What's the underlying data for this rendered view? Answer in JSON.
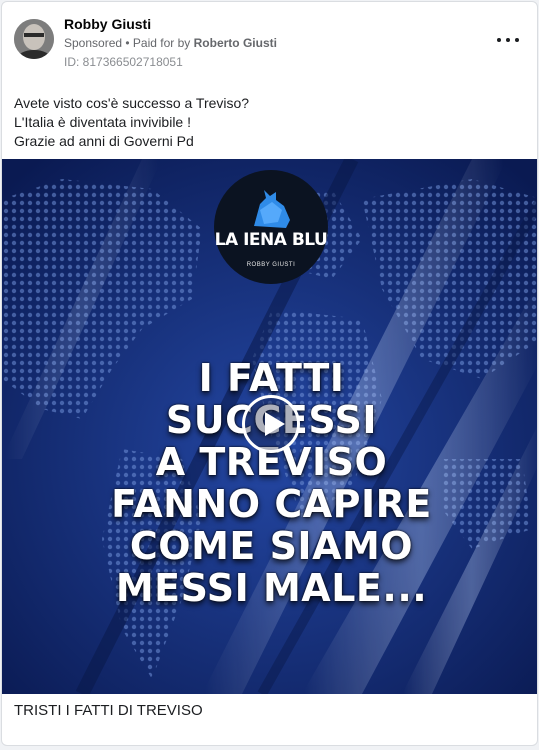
{
  "post": {
    "author": "Robby Giusti",
    "sponsored_label": "Sponsored",
    "paid_for_prefix": "• Paid for by",
    "paid_for_name": "Roberto Giusti",
    "ad_id": "ID: 817366502718051",
    "more_icon": "ellipsis-icon",
    "body_lines": [
      "Avete visto cos'è successo a Treviso?",
      "L'Italia è diventata invivibile !",
      "Grazie ad anni di Governi Pd"
    ],
    "caption": "TRISTI I FATTI DI TREVISO"
  },
  "media": {
    "logo_title": "LA IENA BLU",
    "logo_subtitle": "ROBBY GIUSTI",
    "headline_lines": [
      "I FATTI",
      "SUCCESSI",
      "A TREVISO",
      "FANNO CAPIRE",
      "COME SIAMO",
      "MESSI MALE..."
    ],
    "play_icon": "play-icon"
  },
  "colors": {
    "background": "#10266b",
    "accent": "#2f8be8"
  }
}
